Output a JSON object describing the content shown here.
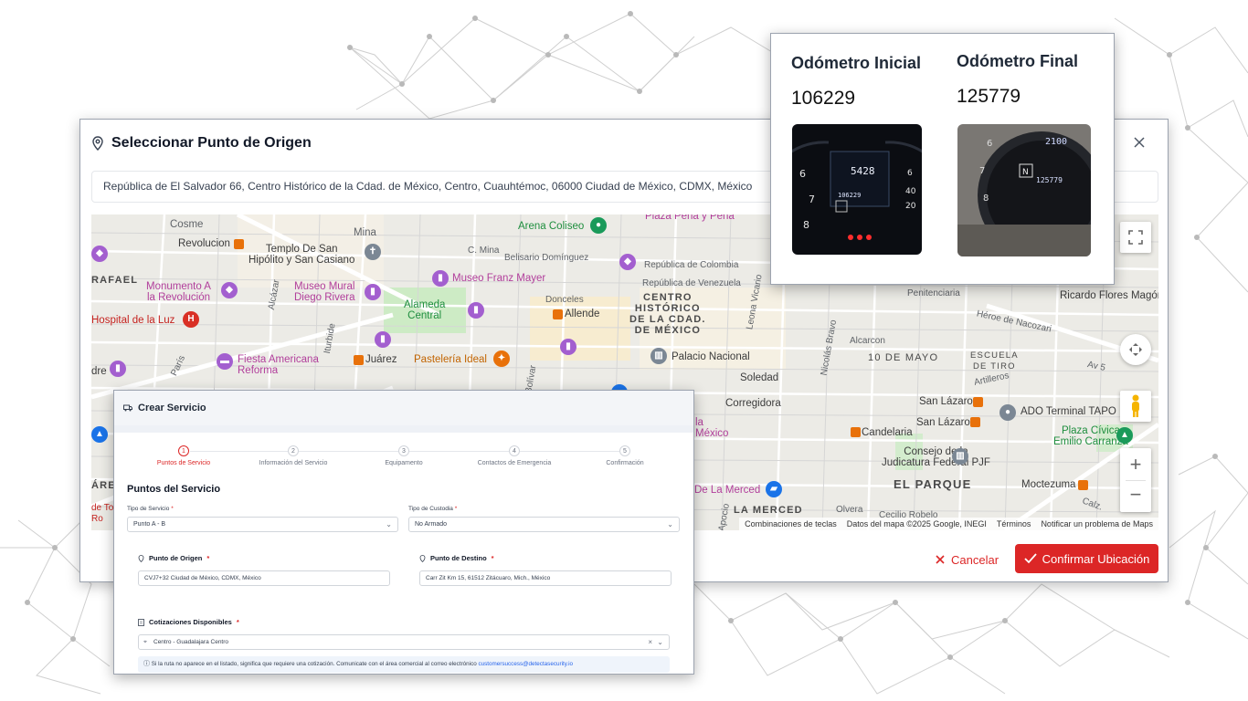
{
  "map_modal": {
    "title": "Seleccionar Punto de Origen",
    "address": "República de El Salvador 66, Centro Histórico de la Cdad. de México, Centro, Cuauhtémoc, 06000 Ciudad de México, CDMX, México",
    "cancel_label": "Cancelar",
    "confirm_label": "Confirmar Ubicación",
    "map_labels": {
      "arena_coliseo": "Arena Coliseo",
      "plaza_pena": "Plaza Peña y Peña",
      "cosme": "Cosme",
      "mina": "Mina",
      "revolucion": "Revolucion",
      "templo_san_hipolito": "Templo De San\nHipólito y San Casiano",
      "c_mina": "C. Mina",
      "belisario": "Belisario Domínguez",
      "rep_colombia": "República de Colombia",
      "rafael": "RAFAEL",
      "monumento": "Monumento A\nla Revolución",
      "museo_mural": "Museo Mural\nDiego Rivera",
      "museo_franz": "Museo Franz Mayer",
      "rep_venezuela": "República de Venezuela",
      "alcazar": "Alcázar",
      "alameda": "Alameda\nCentral",
      "donceles": "Donceles",
      "centro_historico": "CENTRO\nHISTÓRICO\nDE LA CDAD.\nDE MÉXICO",
      "leona_vicario": "Leona Vicario",
      "hospital": "Hospital de la Luz",
      "allende": "Allende",
      "iturbide": "Iturbide",
      "fiesta_americana": "Fiesta Americana\nReforma",
      "juarez": "Juárez",
      "pasteleria": "Pastelería Ideal",
      "palacio": "Palacio Nacional",
      "dre": "dre",
      "paris": "París",
      "bolivar": "Simón Bolívar",
      "soledad": "Soledad",
      "nicolas_bravo": "Nicolás Bravo",
      "corregidora": "Corregidora",
      "la_mexico": "la\nMéxico",
      "penitenciaria": "Penitenciaria",
      "ricardo": "Ricardo Flores Magón",
      "heroe": "Héroe de Nacozari",
      "alcarcon": "Alcarcon",
      "diez_mayo": "10 DE MAYO",
      "escuela_tiro": "ESCUELA\nDE TIRO",
      "av5": "Av 5",
      "artilleros": "Artilleros",
      "san_lazaro1": "San Lázaro",
      "san_lazaro2": "San Lázaro",
      "ado": "ADO Terminal TAPO",
      "candelaria": "Candelaria",
      "plaza_civica": "Plaza Cívica\nEmilio Carranza",
      "consejo": "Consejo de la\nJudicatura Federal PJF",
      "are": "ÁRE",
      "el_parque": "EL PARQUE",
      "moctezuma": "Moctezuma",
      "la_merced_mkt": "De La Merced",
      "la_merced": "LA MERCED",
      "olvera": "Olvera",
      "cecilio": "Cecilio Robelo",
      "calz": "Calz.",
      "de_to": "de To\nRo",
      "apocio": "Apocio"
    },
    "map_footer": [
      "Combinaciones de teclas",
      "Datos del mapa ©2025 Google, INEGI",
      "Términos",
      "Notificar un problema de Maps"
    ]
  },
  "odometer": {
    "initial_title": "Odómetro Inicial",
    "initial_value": "106229",
    "final_title": "Odómetro Final",
    "final_value": "125779"
  },
  "service": {
    "header": "Crear Servicio",
    "steps": [
      {
        "num": "1",
        "label": "Puntos de Servicio"
      },
      {
        "num": "2",
        "label": "Información del Servicio"
      },
      {
        "num": "3",
        "label": "Equipamento"
      },
      {
        "num": "4",
        "label": "Contactos de Emergencia"
      },
      {
        "num": "5",
        "label": "Confirmación"
      }
    ],
    "section_title": "Puntos del Servicio",
    "tipo_servicio_label": "Tipo de Servicio",
    "tipo_servicio_value": "Punto A - B",
    "tipo_custodia_label": "Tipo de Custodia",
    "tipo_custodia_value": "No Armado",
    "origen_label": "Punto de Origen",
    "origen_value": "CVJ7+32 Ciudad de México, CDMX, México",
    "destino_label": "Punto de Destino",
    "destino_value": "Carr Zit Km 15, 61512 Zitácuaro, Mich., México",
    "cotizaciones_label": "Cotizaciones Disponibles",
    "cotizaciones_value": "Centro - Guadalajara Centro",
    "info_text": "Si la ruta no aparece en el listado, significa que requiere una cotización. Comunicate con el área comercial al correo electrónico",
    "info_email": "customersuccess@detectasecurity.io"
  },
  "colors": {
    "accent": "#dc2626",
    "map_bg": "#ecebe6",
    "poi_purple": "#a35fcf"
  }
}
